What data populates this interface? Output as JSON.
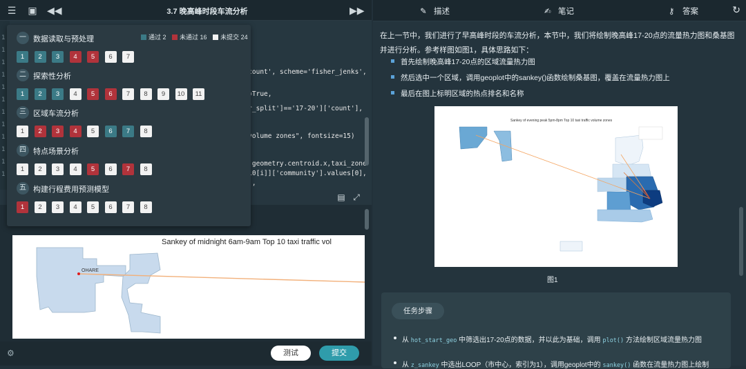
{
  "window": {
    "title": "3.7 晚高峰时段车流分析"
  },
  "code": {
    "line_numbers": [
      "1",
      "1",
      "1",
      "1",
      "1",
      "1",
      "1",
      "1",
      "1",
      "1",
      "1",
      "1",
      "1",
      "1",
      "1",
      "1",
      "1"
    ],
    "lines": [
      "m='count', scheme='fisher_jenks',",
      ",",
      "end=True,",
      "hour_split']=='17-20']['count'],",
      "",
      "ic volume zones\", fontsize=15)",
      "",
      "i]].geometry.centroid.x,taxi_zone",
      "op_10[i]]['community'].values[0],",
      "001),"
    ]
  },
  "menu": {
    "legend": {
      "passed": "通过 2",
      "failed": "未通过 16",
      "unsubmitted": "未提交 24"
    },
    "sections": [
      {
        "num": "一",
        "name": "数据读取与预处理",
        "boxes": [
          [
            "1",
            "pass"
          ],
          [
            "2",
            "pass"
          ],
          [
            "3",
            "pass"
          ],
          [
            "4",
            "fail"
          ],
          [
            "5",
            "fail"
          ],
          [
            "6",
            "none"
          ],
          [
            "7",
            "none"
          ]
        ]
      },
      {
        "num": "二",
        "name": "探索性分析",
        "boxes": [
          [
            "1",
            "pass"
          ],
          [
            "2",
            "pass"
          ],
          [
            "3",
            "pass"
          ],
          [
            "4",
            "none"
          ],
          [
            "5",
            "fail"
          ],
          [
            "6",
            "fail"
          ],
          [
            "7",
            "none"
          ],
          [
            "8",
            "none"
          ],
          [
            "9",
            "none"
          ],
          [
            "10",
            "none"
          ],
          [
            "11",
            "none"
          ]
        ]
      },
      {
        "num": "三",
        "name": "区域车流分析",
        "boxes": [
          [
            "1",
            "none"
          ],
          [
            "2",
            "fail"
          ],
          [
            "3",
            "fail"
          ],
          [
            "4",
            "fail"
          ],
          [
            "5",
            "none"
          ],
          [
            "6",
            "pass"
          ],
          [
            "7",
            "pass"
          ],
          [
            "8",
            "none"
          ]
        ]
      },
      {
        "num": "四",
        "name": "特点场景分析",
        "boxes": [
          [
            "1",
            "none"
          ],
          [
            "2",
            "none"
          ],
          [
            "3",
            "none"
          ],
          [
            "4",
            "none"
          ],
          [
            "5",
            "fail"
          ],
          [
            "6",
            "none"
          ],
          [
            "7",
            "fail"
          ],
          [
            "8",
            "none"
          ]
        ]
      },
      {
        "num": "五",
        "name": "构建行程费用预测模型",
        "boxes": [
          [
            "1",
            "fail"
          ],
          [
            "2",
            "none"
          ],
          [
            "3",
            "none"
          ],
          [
            "4",
            "none"
          ],
          [
            "5",
            "none"
          ],
          [
            "6",
            "none"
          ],
          [
            "7",
            "none"
          ],
          [
            "8",
            "none"
          ]
        ]
      }
    ]
  },
  "output": {
    "chart_title": "Sankey of midnight 6am-9am Top 10 taxi traffic vol",
    "marker_label": "OHARE"
  },
  "buttons": {
    "test": "测试",
    "submit": "提交"
  },
  "tabs": [
    {
      "label": "描述",
      "icon": "edit-icon"
    },
    {
      "label": "笔记",
      "icon": "note-icon"
    },
    {
      "label": "答案",
      "icon": "key-icon"
    }
  ],
  "description": {
    "paragraph": "在上一节中，我们进行了早高峰时段的车流分析，本节中，我们将绘制晚高峰17-20点的流量热力图和桑基图并进行分析。参考样图如图1，具体思路如下：",
    "bullets": [
      "首先绘制晚高峰17-20点的区域流量热力图",
      "然后选中一个区域，调用geoplot中的sankey()函数绘制桑基图，覆盖在流量热力图上",
      "最后在图上标明区域的热点排名和名称"
    ],
    "figure_title": "Sankey of evening peak 5pm-8pm Top 10 taxi traffic volume zones",
    "figure_caption": "图1"
  },
  "task": {
    "heading": "任务步骤",
    "step1": {
      "prefix": "从",
      "code1": "hot_start_geo",
      "mid": "中筛选出17-20点的数据，并以此为基础，调用",
      "code2": "plot()",
      "suffix": "方法绘制区域流量热力图"
    },
    "step2": {
      "prefix": "从",
      "code1": "z_sankey",
      "mid": "中选出LOOP（市中心，索引为1），调用geoplot中的",
      "code2": "sankey()",
      "suffix": "函数在流量热力图上绘制"
    }
  }
}
